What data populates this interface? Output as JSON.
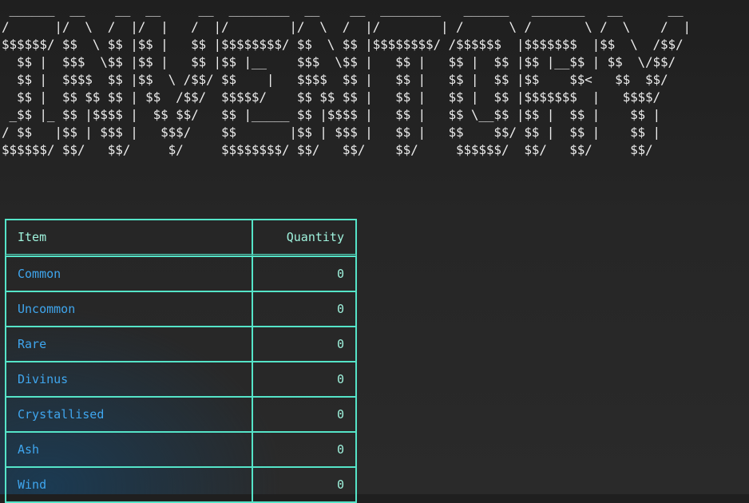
{
  "banner": " ______  __    __  __     __  ________  __    __  ________   ______   _______   __      __ \n/      |/  \\  /  |/  |   /  |/        |/  \\  /  |/        | /      \\ /       \\ /  \\    /  |\n$$$$$$/ $$  \\ $$ |$$ |   $$ |$$$$$$$$/ $$  \\ $$ |$$$$$$$$/ /$$$$$$  |$$$$$$$  |$$  \\  /$$/ \n  $$ |  $$$  \\$$ |$$ |   $$ |$$ |__    $$$  \\$$ |   $$ |   $$ |  $$ |$$ |__$$ | $$  \\/$$/  \n  $$ |  $$$$  $$ |$$  \\ /$$/ $$    |   $$$$  $$ |   $$ |   $$ |  $$ |$$    $$<   $$  $$/   \n  $$ |  $$ $$ $$ | $$  /$$/  $$$$$/    $$ $$ $$ |   $$ |   $$ |  $$ |$$$$$$$  |   $$$$/    \n _$$ |_ $$ |$$$$ |  $$ $$/   $$ |_____ $$ |$$$$ |   $$ |   $$ \\__$$ |$$ |  $$ |    $$ |    \n/ $$   |$$ | $$$ |   $$$/    $$       |$$ | $$$ |   $$ |   $$    $$/ $$ |  $$ |    $$ |    \n$$$$$$/ $$/   $$/     $/     $$$$$$$$/ $$/   $$/    $$/     $$$$$$/  $$/   $$/     $$/     ",
  "table": {
    "headers": {
      "item": "Item",
      "quantity": "Quantity"
    },
    "rows": [
      {
        "item": "Common",
        "quantity": "0"
      },
      {
        "item": "Uncommon",
        "quantity": "0"
      },
      {
        "item": "Rare",
        "quantity": "0"
      },
      {
        "item": "Divinus",
        "quantity": "0"
      },
      {
        "item": "Crystallised",
        "quantity": "0"
      },
      {
        "item": "Ash",
        "quantity": "0"
      },
      {
        "item": "Wind",
        "quantity": "0"
      }
    ]
  },
  "colors": {
    "border": "#55e4c8",
    "item_text": "#3fa6ee",
    "header_text": "#9ff3dd",
    "banner_text": "#ececec"
  }
}
